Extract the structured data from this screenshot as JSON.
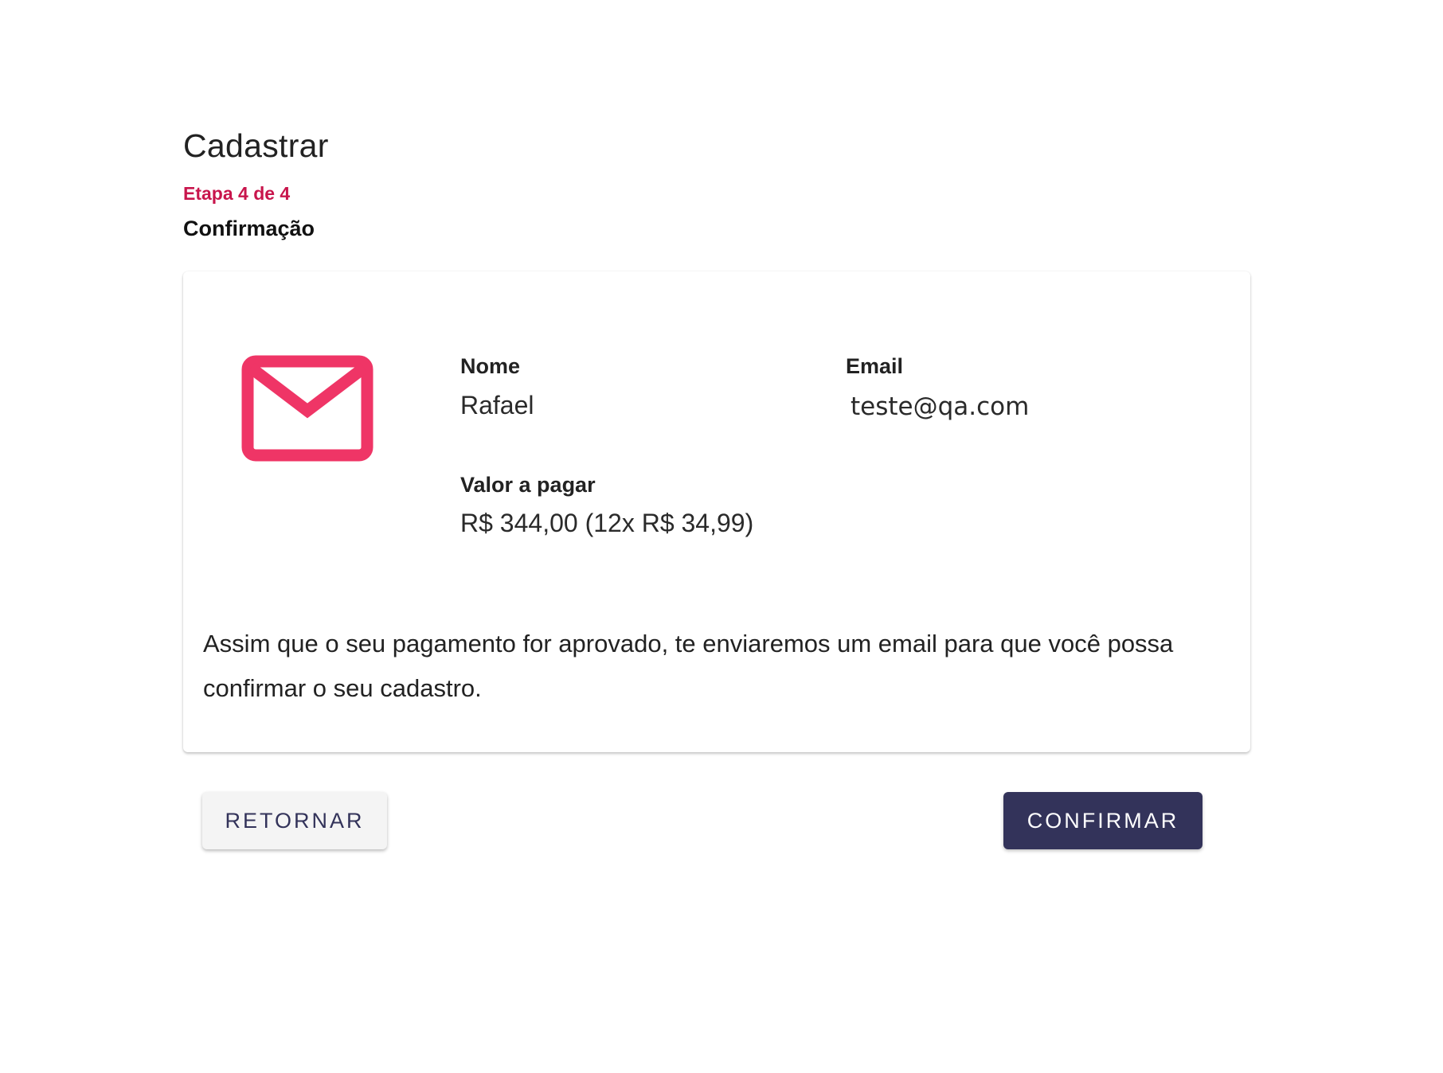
{
  "header": {
    "title": "Cadastrar",
    "step_indicator": "Etapa 4 de 4",
    "step_title": "Confirmação"
  },
  "summary": {
    "icon": "mail-icon",
    "icon_color": "#ef3566",
    "name_label": "Nome",
    "name_value": "Rafael",
    "email_label": "Email",
    "email_value": "teste@qa.com",
    "amount_label": "Valor a pagar",
    "amount_value": "R$ 344,00 (12x R$ 34,99)",
    "message": "Assim que o seu pagamento for aprovado, te enviaremos um email para que você possa confirmar o seu cadastro."
  },
  "actions": {
    "back_label": "Retornar",
    "confirm_label": "Confirmar",
    "primary_color": "#33335a"
  }
}
